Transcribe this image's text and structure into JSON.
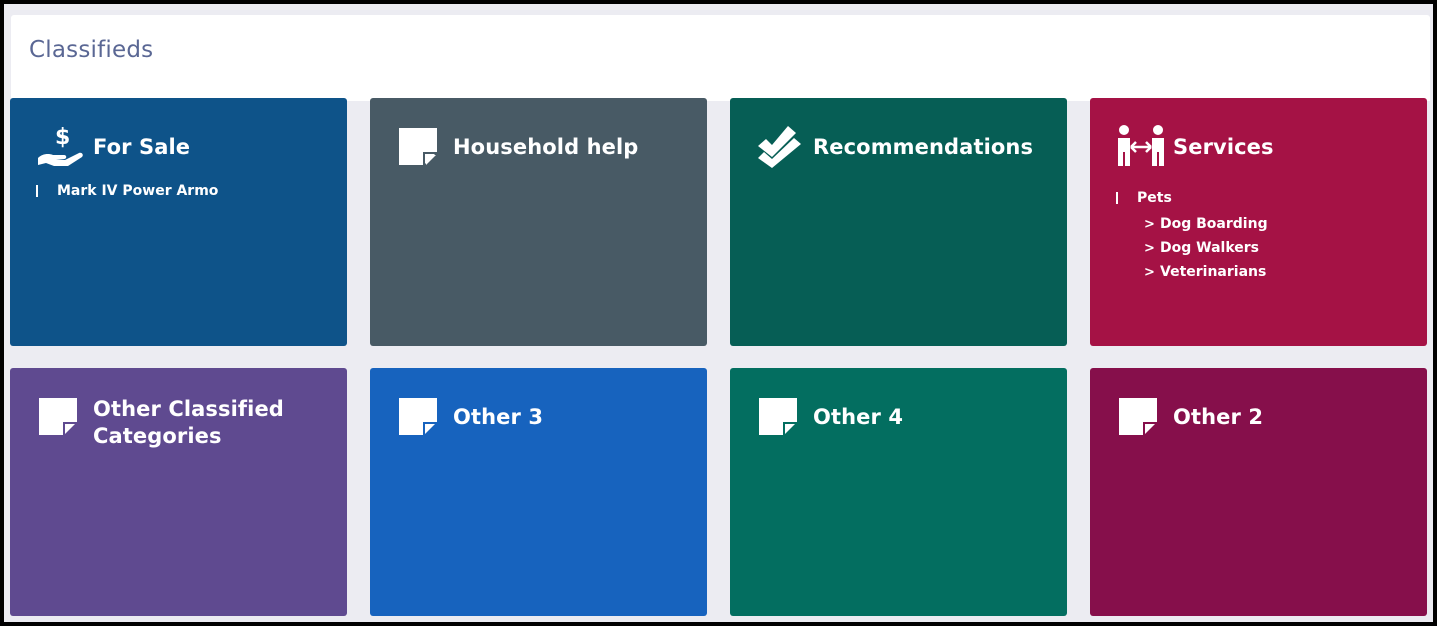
{
  "page": {
    "title": "Classifieds"
  },
  "tiles": [
    {
      "title": "For Sale",
      "icon": "hand-dollar-icon",
      "color": "#0e5389",
      "items": [
        "Mark IV Power Armo"
      ]
    },
    {
      "title": "Household help",
      "icon": "sticky-note-icon",
      "color": "#485a65"
    },
    {
      "title": "Recommendations",
      "icon": "double-check-icon",
      "color": "#065e55"
    },
    {
      "title": "Services",
      "icon": "people-exchange-icon",
      "color": "#a51245",
      "items": [
        {
          "label": "Pets",
          "children": [
            "Dog Boarding",
            "Dog Walkers",
            "Veterinarians"
          ]
        }
      ]
    },
    {
      "title": "Other Classified Categories",
      "icon": "sticky-note-icon",
      "color": "#5f4a90"
    },
    {
      "title": "Other 3",
      "icon": "sticky-note-icon",
      "color": "#1763be"
    },
    {
      "title": "Other 4",
      "icon": "sticky-note-icon",
      "color": "#036e60"
    },
    {
      "title": "Other 2",
      "icon": "sticky-note-icon",
      "color": "#860f4b"
    }
  ],
  "chevron_glyph": ">"
}
